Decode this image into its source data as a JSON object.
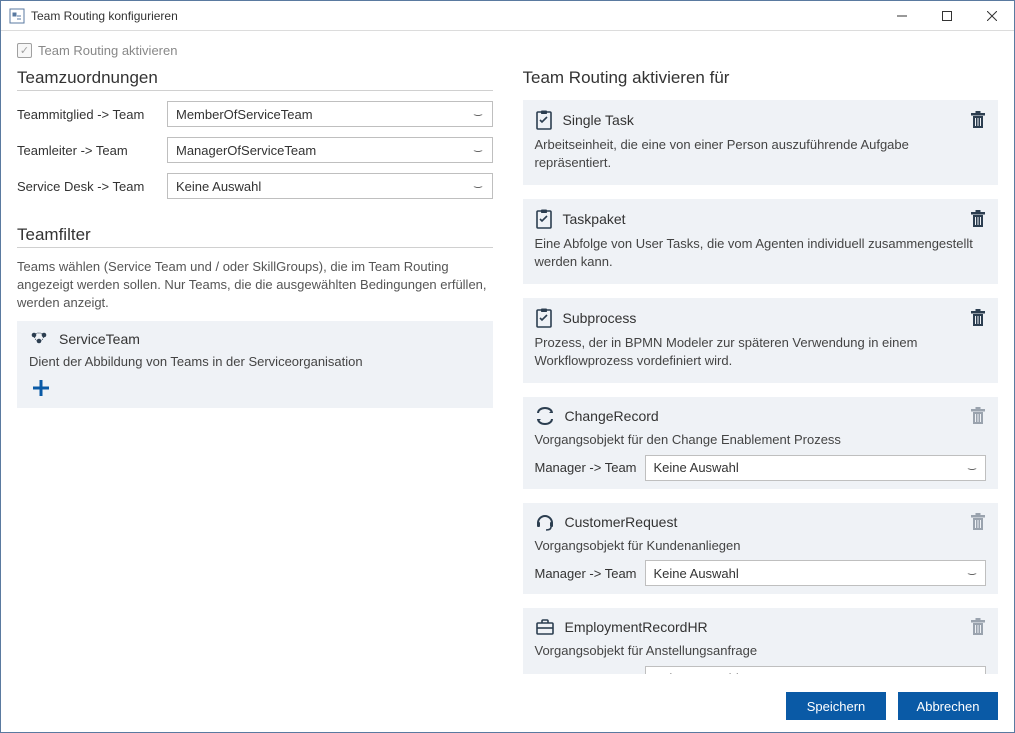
{
  "window": {
    "title": "Team Routing konfigurieren"
  },
  "activate_checkbox": {
    "label": "Team Routing aktivieren",
    "checked": true,
    "enabled": false
  },
  "left": {
    "teamAssignments": {
      "title": "Teamzuordnungen",
      "rows": [
        {
          "label": "Teammitglied -> Team",
          "value": "MemberOfServiceTeam"
        },
        {
          "label": "Teamleiter -> Team",
          "value": "ManagerOfServiceTeam"
        },
        {
          "label": "Service Desk -> Team",
          "value": "Keine Auswahl"
        }
      ]
    },
    "teamfilter": {
      "title": "Teamfilter",
      "help": "Teams wählen (Service Team und / oder SkillGroups), die im Team Routing angezeigt werden sollen. Nur Teams, die die ausgewählten Bedingungen erfüllen, werden anzeigt.",
      "card": {
        "title": "ServiceTeam",
        "desc": "Dient der Abbildung von Teams in der Serviceorganisation"
      }
    }
  },
  "right": {
    "title": "Team Routing aktivieren für",
    "items": [
      {
        "icon": "clipboard",
        "trashEnabled": true,
        "title": "Single Task",
        "desc": "Arbeitseinheit, die eine von einer Person auszuführende Aufgabe repräsentiert."
      },
      {
        "icon": "clipboard",
        "trashEnabled": true,
        "title": "Taskpaket",
        "desc": "Eine Abfolge von User Tasks, die vom Agenten individuell zusammengestellt werden kann."
      },
      {
        "icon": "clipboard",
        "trashEnabled": true,
        "title": "Subprocess",
        "desc": "Prozess, der in BPMN Modeler zur späteren Verwendung in einem Workflowprozess vordefiniert wird."
      },
      {
        "icon": "cycle",
        "trashEnabled": false,
        "title": "ChangeRecord",
        "desc": "Vorgangsobjekt für den Change Enablement Prozess",
        "managerLabel": "Manager -> Team",
        "managerValue": "Keine Auswahl"
      },
      {
        "icon": "headset",
        "trashEnabled": false,
        "title": "CustomerRequest",
        "desc": "Vorgangsobjekt für Kundenanliegen",
        "managerLabel": "Manager -> Team",
        "managerValue": "Keine Auswahl"
      },
      {
        "icon": "briefcase",
        "trashEnabled": false,
        "title": "EmploymentRecordHR",
        "desc": "Vorgangsobjekt für Anstellungsanfrage",
        "managerLabel": "Manager -> Team",
        "managerValue": "Keine Auswahl"
      }
    ]
  },
  "footer": {
    "save": "Speichern",
    "cancel": "Abbrechen"
  }
}
